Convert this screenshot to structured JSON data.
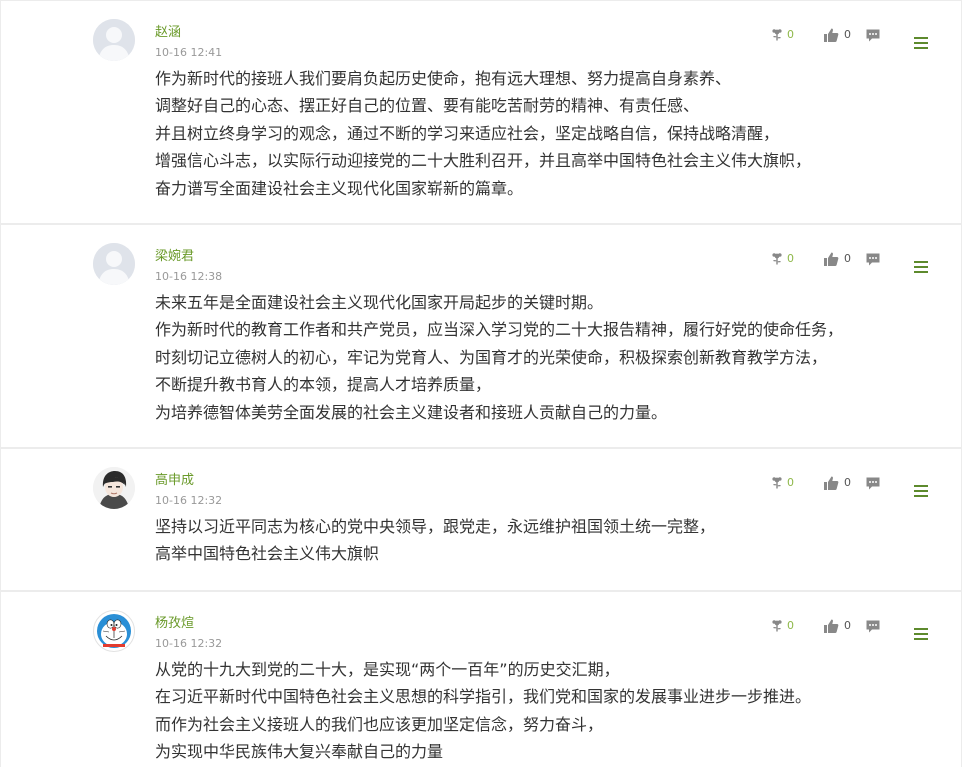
{
  "colors": {
    "author": "#6a9a2a",
    "flower_count": "#8fb84a",
    "icon_gray": "#888888",
    "menu_green": "#5d8a2d",
    "text": "#333333",
    "border": "#ececec"
  },
  "comments": [
    {
      "author": "赵涵",
      "time": "10-16 12:41",
      "avatar": "default-avatar",
      "flowers": "0",
      "likes": "0",
      "lines": [
        "作为新时代的接班人我们要肩负起历史使命，抱有远大理想、努力提高自身素养、",
        "调整好自己的心态、摆正好自己的位置、要有能吃苦耐劳的精神、有责任感、",
        "并且树立终身学习的观念，通过不断的学习来适应社会，坚定战略自信，保持战略清醒，",
        "增强信心斗志，以实际行动迎接党的二十大胜利召开，并且高举中国特色社会主义伟大旗帜，",
        "奋力谱写全面建设社会主义现代化国家崭新的篇章。"
      ]
    },
    {
      "author": "梁婉君",
      "time": "10-16 12:38",
      "avatar": "default-avatar",
      "flowers": "0",
      "likes": "0",
      "lines": [
        "未来五年是全面建设社会主义现代化国家开局起步的关键时期。",
        "作为新时代的教育工作者和共产党员，应当深入学习党的二十大报告精神，履行好党的使命任务，",
        "时刻切记立德树人的初心，牢记为党育人、为国育才的光荣使命，积极探索创新教育教学方法，",
        "不断提升教书育人的本领，提高人才培养质量，",
        "为培养德智体美劳全面发展的社会主义建设者和接班人贡献自己的力量。"
      ]
    },
    {
      "author": "高申成",
      "time": "10-16 12:32",
      "avatar": "anime-avatar",
      "flowers": "0",
      "likes": "0",
      "lines": [
        "坚持以习近平同志为核心的党中央领导，跟党走，永远维护祖国领土统一完整，",
        "高举中国特色社会主义伟大旗帜"
      ]
    },
    {
      "author": "杨孜煊",
      "time": "10-16 12:32",
      "avatar": "doraemon-avatar",
      "flowers": "0",
      "likes": "0",
      "lines": [
        "从党的十九大到党的二十大，是实现“两个一百年”的历史交汇期，",
        "在习近平新时代中国特色社会主义思想的科学指引，我们党和国家的发展事业进步一步推进。",
        "而作为社会主义接班人的我们也应该更加坚定信念，努力奋斗，",
        "为实现中华民族伟大复兴奉献自己的力量"
      ]
    }
  ]
}
